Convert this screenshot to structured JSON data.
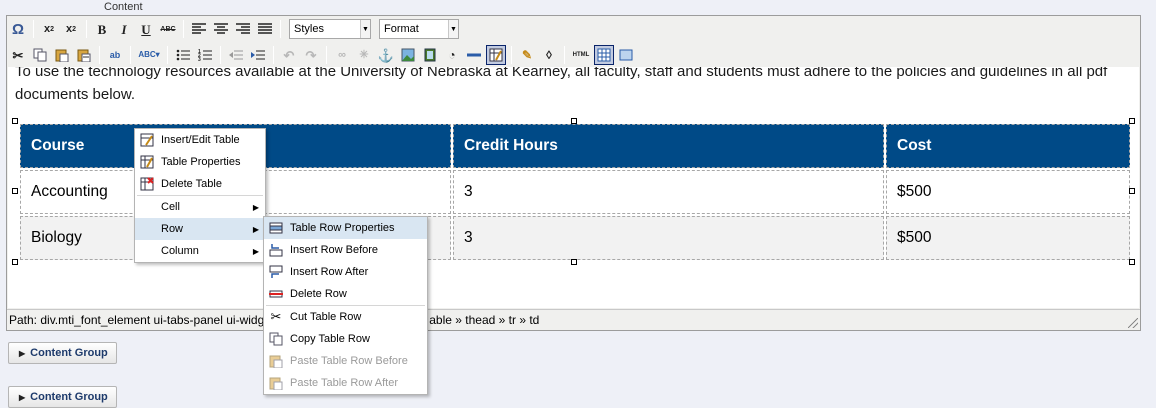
{
  "field_label": "Content",
  "toolbar": {
    "row1": [
      {
        "name": "omega-icon",
        "glyph": "Ω"
      },
      {
        "sep": true
      },
      {
        "name": "subscript-icon",
        "glyph": "x₂"
      },
      {
        "name": "superscript-icon",
        "glyph": "x²"
      },
      {
        "sep": true
      },
      {
        "name": "bold-icon",
        "glyph": "B"
      },
      {
        "name": "italic-icon",
        "glyph": "I"
      },
      {
        "name": "underline-icon",
        "glyph": "U"
      },
      {
        "name": "strikethrough-icon",
        "glyph": "ABC"
      },
      {
        "sep": true
      },
      {
        "name": "align-left-icon",
        "glyph": "≡"
      },
      {
        "name": "align-center-icon",
        "glyph": "≡"
      },
      {
        "name": "align-right-icon",
        "glyph": "≡"
      },
      {
        "name": "align-justify-icon",
        "glyph": "≡"
      },
      {
        "sep": true
      }
    ],
    "styles_label": "Styles",
    "format_label": "Format"
  },
  "intro_text": "To use the technology resources available at the University of Nebraska at Kearney, all faculty, staff and students must adhere to the policies and guidelines in all pdf documents below.",
  "table": {
    "headers": [
      "Course",
      "Credit Hours",
      "Cost"
    ],
    "rows": [
      [
        "Accounting",
        "3",
        "$500"
      ],
      [
        "Biology",
        "3",
        "$500"
      ]
    ]
  },
  "path_bar": "Path: div.mti_font_element ui-tabs-panel ui-widg",
  "path_bar_tail": "able  » thead  » tr  » td",
  "content_groups": [
    "Content Group",
    "Content Group"
  ],
  "context_menu": [
    {
      "label": "Insert/Edit Table",
      "icon": "table-edit-icon"
    },
    {
      "label": "Table Properties",
      "icon": "table-properties-icon"
    },
    {
      "label": "Delete Table",
      "icon": "table-delete-icon"
    },
    {
      "label": "Cell",
      "submenu": true
    },
    {
      "label": "Row",
      "submenu": true,
      "highlight": true
    },
    {
      "label": "Column",
      "submenu": true
    }
  ],
  "row_submenu": [
    {
      "label": "Table Row Properties",
      "icon": "row-properties-icon",
      "highlight": true
    },
    {
      "label": "Insert Row Before",
      "icon": "insert-row-before-icon"
    },
    {
      "label": "Insert Row After",
      "icon": "insert-row-after-icon"
    },
    {
      "label": "Delete Row",
      "icon": "delete-row-icon"
    },
    {
      "label": "Cut Table Row",
      "icon": "scissors-icon"
    },
    {
      "label": "Copy Table Row",
      "icon": "copy-icon"
    },
    {
      "label": "Paste Table Row Before",
      "icon": "paste-icon",
      "disabled": true
    },
    {
      "label": "Paste Table Row After",
      "icon": "paste-icon",
      "disabled": true
    }
  ],
  "colors": {
    "header_bg": "#004a87",
    "menu_highlight": "#d9e6f2",
    "page_bg": "#eef0f7"
  }
}
